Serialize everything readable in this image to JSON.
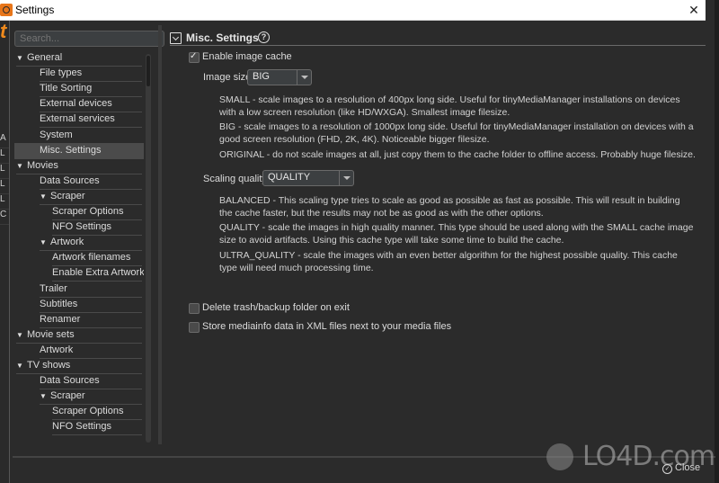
{
  "window": {
    "title": "Settings",
    "close_glyph": "✕"
  },
  "search": {
    "placeholder": "Search..."
  },
  "nav": [
    {
      "label": "General",
      "level": 0,
      "expandable": true
    },
    {
      "label": "File types",
      "level": 1
    },
    {
      "label": "Title Sorting",
      "level": 1
    },
    {
      "label": "External devices",
      "level": 1
    },
    {
      "label": "External services",
      "level": 1
    },
    {
      "label": "System",
      "level": 1
    },
    {
      "label": "Misc. Settings",
      "level": 1,
      "selected": true
    },
    {
      "label": "Movies",
      "level": 0,
      "expandable": true
    },
    {
      "label": "Data Sources",
      "level": 1
    },
    {
      "label": "Scraper",
      "level": 1,
      "expandable": true
    },
    {
      "label": "Scraper Options",
      "level": 2
    },
    {
      "label": "NFO Settings",
      "level": 2
    },
    {
      "label": "Artwork",
      "level": 1,
      "expandable": true
    },
    {
      "label": "Artwork filenames",
      "level": 2
    },
    {
      "label": "Enable Extra Artwork",
      "level": 2
    },
    {
      "label": "Trailer",
      "level": 1
    },
    {
      "label": "Subtitles",
      "level": 1
    },
    {
      "label": "Renamer",
      "level": 1
    },
    {
      "label": "Movie sets",
      "level": 0,
      "expandable": true
    },
    {
      "label": "Artwork",
      "level": 1
    },
    {
      "label": "TV shows",
      "level": 0,
      "expandable": true
    },
    {
      "label": "Data Sources",
      "level": 1
    },
    {
      "label": "Scraper",
      "level": 1,
      "expandable": true
    },
    {
      "label": "Scraper Options",
      "level": 2
    },
    {
      "label": "NFO Settings",
      "level": 2
    }
  ],
  "section": {
    "title": "Misc. Settings",
    "help_glyph": "?",
    "enable_image_cache": {
      "label": "Enable image cache",
      "checked": true
    },
    "image_size": {
      "label": "Image size",
      "value": "BIG"
    },
    "image_size_desc": [
      "SMALL - scale images to a resolution of 400px long side. Useful for tinyMediaManager installations on devices with a low screen resolution (like HD/WXGA). Smallest image filesize.",
      "BIG - scale images to a resolution of 1000px long side. Useful for tinyMediaManager installation on devices with a good screen resolution (FHD, 2K, 4K). Noticeable bigger filesize.",
      "ORIGINAL - do not scale images at all, just copy them to the cache folder to offline access. Probably huge filesize."
    ],
    "scaling_quality": {
      "label": "Scaling quality",
      "value": "QUALITY"
    },
    "scaling_quality_desc": [
      "BALANCED - This scaling type tries to scale as good as possible as fast as possible. This will result in building the cache faster, but the results may not be as good as with the other options.",
      "QUALITY - scale the images in high quality manner. This type should be used along with the SMALL cache image size to avoid artifacts. Using this cache type will take some time to build the cache.",
      "ULTRA_QUALITY - scale the images with an even better algorithm for the highest possible quality. This cache type will need much processing time."
    ],
    "delete_trash": {
      "label": "Delete trash/backup folder on exit",
      "checked": false
    },
    "store_mediainfo": {
      "label": "Store mediainfo data in XML files next to your media files",
      "checked": false
    }
  },
  "footer": {
    "close_label": "Close",
    "close_icon": "✓"
  },
  "watermark": {
    "text": "LO4D.com"
  },
  "background_app": {
    "row_letters": [
      "A",
      "L",
      "L",
      "L",
      "L",
      "C"
    ]
  }
}
